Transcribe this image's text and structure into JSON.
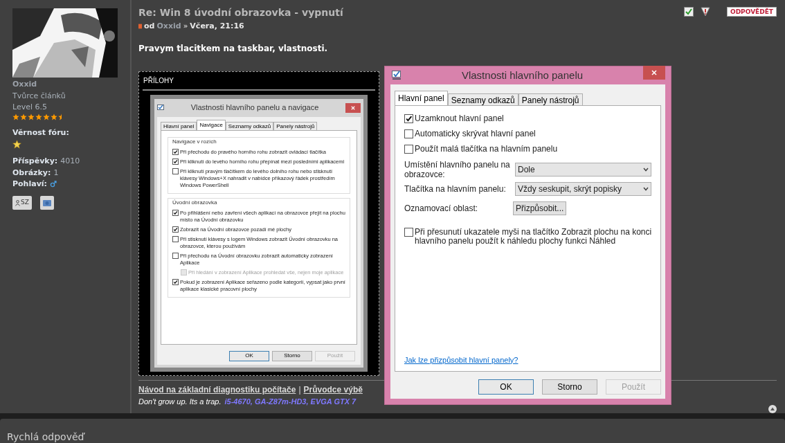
{
  "user": {
    "name": "Oxxid",
    "rank": "Tvůrce článků",
    "level": "Level 6.5",
    "stars": 6.5,
    "loyalty_label": "Věrnost fóru:",
    "stats": [
      {
        "label": "Příspěvky:",
        "value": "4010"
      },
      {
        "label": "Obrázky:",
        "value": "1"
      }
    ],
    "gender_label": "Pohlaví:",
    "pm_label": "SZ"
  },
  "post": {
    "title": "Re: Win 8 úvodní obrazovka - vypnutí",
    "by": "od",
    "author": "Oxxid",
    "sep": "»",
    "date": "Včera, 21:16",
    "body": "Pravym tlacitkem na taskbar, vlastnosti.",
    "reply_button": "ODPOVĚDĚT"
  },
  "attachments": {
    "title": "PŘÍLOHY",
    "dialog": {
      "title": "Vlastnosti hlavního panelu a navigace",
      "tabs": [
        {
          "label": "Hlavní panel",
          "selected": false
        },
        {
          "label": "Navigace",
          "selected": true
        },
        {
          "label": "Seznamy odkazů",
          "selected": false
        },
        {
          "label": "Panely nástrojů",
          "selected": false
        }
      ],
      "groups": [
        {
          "title": "Navigace v rozích",
          "options": [
            {
              "label": "Při přechodu do pravého horního rohu zobrazit ovládací tlačítka",
              "checked": true,
              "disabled": false,
              "indented": false
            },
            {
              "label": "Při kliknutí do levého horního rohu přepínat mezi posledními aplikacemi",
              "checked": true,
              "disabled": false,
              "indented": false
            },
            {
              "label": "Při kliknutí pravým tlačítkem do levého dolního rohu nebo stisknutí klávesy Windows+X nahradit v nabídce příkazový řádek prostředím Windows PowerShell",
              "checked": false,
              "disabled": false,
              "indented": false
            }
          ]
        },
        {
          "title": "Úvodní obrazovka",
          "options": [
            {
              "label": "Po přihlášení nebo zavření všech aplikací na obrazovce přejít na plochu místo na Úvodní obrazovku",
              "checked": true,
              "disabled": false,
              "indented": false
            },
            {
              "label": "Zobrazit na Úvodní obrazovce pozadí mé plochy",
              "checked": true,
              "disabled": false,
              "indented": false
            },
            {
              "label": "Při stisknutí klávesy s logem Windows zobrazit Úvodní obrazovku na obrazovce, kterou používám",
              "checked": false,
              "disabled": false,
              "indented": false
            },
            {
              "label": "Při přechodu na Úvodní obrazovku zobrazit automaticky zobrazení Aplikace",
              "checked": false,
              "disabled": false,
              "indented": false
            },
            {
              "label": "Při hledání v zobrazení Aplikace prohledat vše, nejen moje aplikace",
              "checked": false,
              "disabled": true,
              "indented": true
            },
            {
              "label": "Pokud je zobrazení Aplikace seřazeno podle kategorií, vypsat jako první aplikace klasické pracovní plochy",
              "checked": true,
              "disabled": false,
              "indented": false
            }
          ]
        }
      ],
      "buttons": [
        {
          "label": "OK",
          "default": true,
          "disabled": false
        },
        {
          "label": "Storno",
          "default": false,
          "disabled": false
        },
        {
          "label": "Použít",
          "default": false,
          "disabled": true
        }
      ]
    }
  },
  "dialog": {
    "title": "Vlastnosti hlavního panelu",
    "tabs": [
      {
        "label": "Hlavní panel",
        "selected": true
      },
      {
        "label": "Seznamy odkazů",
        "selected": false
      },
      {
        "label": "Panely nástrojů",
        "selected": false
      }
    ],
    "items": [
      {
        "kind": "checkbox",
        "label": "Uzamknout hlavní panel",
        "checked": true
      },
      {
        "kind": "checkbox",
        "label": "Automaticky skrývat hlavní panel",
        "checked": false
      },
      {
        "kind": "checkbox",
        "label": "Použít malá tlačítka na hlavním panelu",
        "checked": false
      },
      {
        "kind": "select",
        "label": "Umístění hlavního panelu na obrazovce:",
        "value": "Dole"
      },
      {
        "kind": "select",
        "label": "Tlačítka na hlavním panelu:",
        "value": "Vždy seskupit, skrýt popisky"
      },
      {
        "kind": "button",
        "label": "Oznamovací oblast:",
        "value": "Přizpůsobit..."
      },
      {
        "kind": "checkbox",
        "label": "Při přesunutí ukazatele myši na tlačítko Zobrazit plochu na konci hlavního panelu použít k náhledu plochy funkci Náhled",
        "checked": false
      }
    ],
    "help_link": "Jak lze přizpůsobit hlavní panely?",
    "buttons": [
      {
        "label": "OK",
        "default": true,
        "disabled": false
      },
      {
        "label": "Storno",
        "default": false,
        "disabled": false
      },
      {
        "label": "Použít",
        "default": false,
        "disabled": true
      }
    ]
  },
  "signature": {
    "links": [
      "Návod na základní diagnostiku počítače",
      "Průvodce výbě"
    ],
    "separator": "|",
    "motto": "Don't grow up. Its a trap.",
    "specs": "i5-4670, GA-Z87m-HD3, EVGA GTX 7"
  },
  "quick_reply": {
    "title": "Rychlá odpověď"
  }
}
